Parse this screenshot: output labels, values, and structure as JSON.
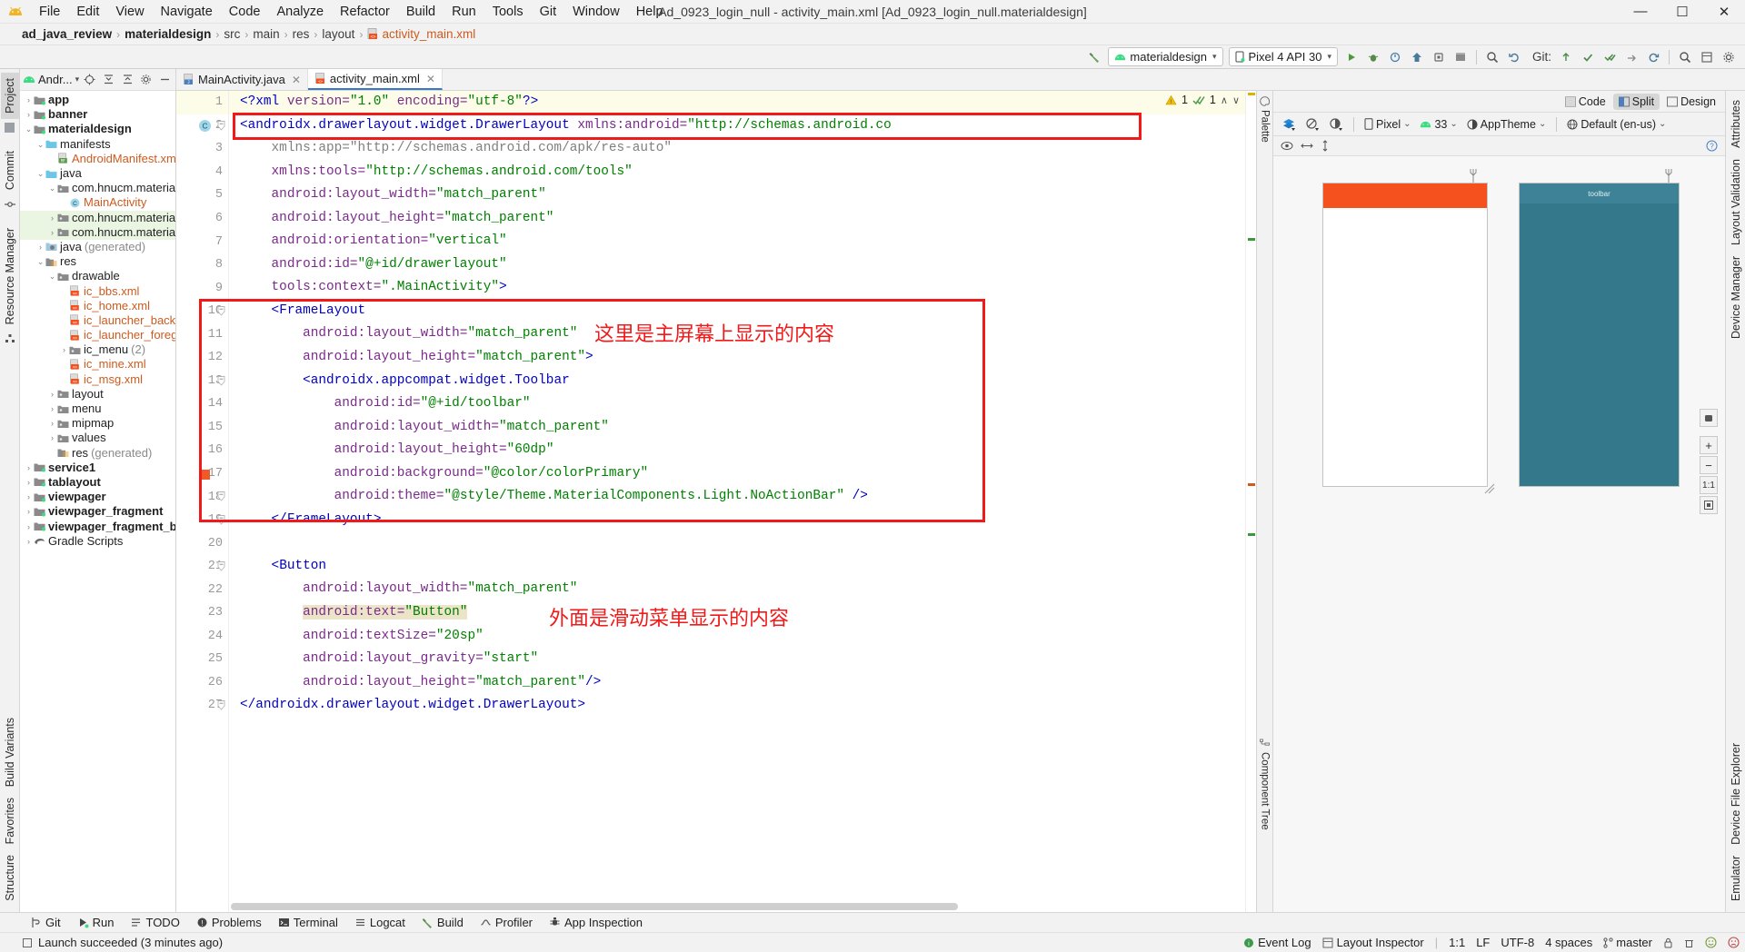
{
  "window": {
    "title": "Ad_0923_login_null - activity_main.xml [Ad_0923_login_null.materialdesign]",
    "minimize": "—",
    "maximize": "☐",
    "close": "✕"
  },
  "menubar": {
    "items": [
      {
        "label": "File"
      },
      {
        "label": "Edit"
      },
      {
        "label": "View"
      },
      {
        "label": "Navigate"
      },
      {
        "label": "Code"
      },
      {
        "label": "Analyze"
      },
      {
        "label": "Refactor"
      },
      {
        "label": "Build"
      },
      {
        "label": "Run"
      },
      {
        "label": "Tools"
      },
      {
        "label": "Git"
      },
      {
        "label": "Window"
      },
      {
        "label": "Help"
      }
    ]
  },
  "breadcrumb": {
    "items": [
      "ad_java_review",
      "materialdesign",
      "src",
      "main",
      "res",
      "layout",
      "activity_main.xml"
    ]
  },
  "toolbar": {
    "run_config": "materialdesign",
    "device": "Pixel 4 API 30",
    "git_label": "Git:",
    "caret": "▾"
  },
  "left_tool_strip": {
    "tabs": [
      "Project",
      "Commit",
      "Resource Manager"
    ],
    "bottom_tabs": [
      "Structure",
      "Favorites",
      "Build Variants"
    ]
  },
  "right_tool_strip": {
    "tabs": [
      "Attributes",
      "Layout Validation",
      "Device Manager",
      "Emulator",
      "Device File Explorer"
    ]
  },
  "project_panel": {
    "title": "Andr...",
    "tree": [
      {
        "indent": 0,
        "arrow": "›",
        "icon": "module-icon",
        "label": "app",
        "bold": true
      },
      {
        "indent": 0,
        "arrow": "›",
        "icon": "module-icon",
        "label": "banner",
        "bold": true
      },
      {
        "indent": 0,
        "arrow": "⌄",
        "icon": "module-icon",
        "label": "materialdesign",
        "bold": true
      },
      {
        "indent": 1,
        "arrow": "⌄",
        "icon": "folder-icon",
        "label": "manifests",
        "bold": false
      },
      {
        "indent": 2,
        "arrow": "",
        "icon": "manifest-file-icon",
        "label": "AndroidManifest.xml",
        "color": "orange"
      },
      {
        "indent": 1,
        "arrow": "⌄",
        "icon": "folder-icon",
        "label": "java",
        "bold": false
      },
      {
        "indent": 2,
        "arrow": "⌄",
        "icon": "package-icon",
        "label": "com.hnucm.materialdes",
        "bold": false
      },
      {
        "indent": 3,
        "arrow": "",
        "icon": "class-icon",
        "label": "MainActivity",
        "color": "orange"
      },
      {
        "indent": 2,
        "arrow": "›",
        "icon": "package-icon",
        "label": "com.hnucm.materialdes",
        "selected": true
      },
      {
        "indent": 2,
        "arrow": "›",
        "icon": "package-icon",
        "label": "com.hnucm.materialdes",
        "selected": true
      },
      {
        "indent": 1,
        "arrow": "›",
        "icon": "gen-folder-icon",
        "label": "java",
        "suffix": "(generated)"
      },
      {
        "indent": 1,
        "arrow": "⌄",
        "icon": "res-folder-icon",
        "label": "res",
        "bold": false
      },
      {
        "indent": 2,
        "arrow": "⌄",
        "icon": "package-icon",
        "label": "drawable",
        "bold": false
      },
      {
        "indent": 3,
        "arrow": "",
        "icon": "xml-file-icon",
        "label": "ic_bbs.xml",
        "color": "orange"
      },
      {
        "indent": 3,
        "arrow": "",
        "icon": "xml-file-icon",
        "label": "ic_home.xml",
        "color": "orange"
      },
      {
        "indent": 3,
        "arrow": "",
        "icon": "xml-file-icon",
        "label": "ic_launcher_backgro",
        "color": "orange"
      },
      {
        "indent": 3,
        "arrow": "",
        "icon": "xml-file-icon",
        "label": "ic_launcher_foregrou",
        "color": "orange"
      },
      {
        "indent": 3,
        "arrow": "›",
        "icon": "package-icon",
        "label": "ic_menu",
        "suffix": "(2)"
      },
      {
        "indent": 3,
        "arrow": "",
        "icon": "xml-file-icon",
        "label": "ic_mine.xml",
        "color": "orange"
      },
      {
        "indent": 3,
        "arrow": "",
        "icon": "xml-file-icon",
        "label": "ic_msg.xml",
        "color": "orange"
      },
      {
        "indent": 2,
        "arrow": "›",
        "icon": "package-icon",
        "label": "layout",
        "bold": false
      },
      {
        "indent": 2,
        "arrow": "›",
        "icon": "package-icon",
        "label": "menu",
        "bold": false
      },
      {
        "indent": 2,
        "arrow": "›",
        "icon": "package-icon",
        "label": "mipmap",
        "bold": false
      },
      {
        "indent": 2,
        "arrow": "›",
        "icon": "package-icon",
        "label": "values",
        "bold": false
      },
      {
        "indent": 2,
        "arrow": "",
        "icon": "res-folder-icon",
        "label": "res",
        "suffix": "(generated)"
      },
      {
        "indent": 0,
        "arrow": "›",
        "icon": "module-icon",
        "label": "service1",
        "bold": true
      },
      {
        "indent": 0,
        "arrow": "›",
        "icon": "module-icon",
        "label": "tablayout",
        "bold": true
      },
      {
        "indent": 0,
        "arrow": "›",
        "icon": "module-icon",
        "label": "viewpager",
        "bold": true
      },
      {
        "indent": 0,
        "arrow": "›",
        "icon": "module-icon",
        "label": "viewpager_fragment",
        "bold": true
      },
      {
        "indent": 0,
        "arrow": "›",
        "icon": "module-icon",
        "label": "viewpager_fragment_bottom",
        "bold": true
      },
      {
        "indent": 0,
        "arrow": "›",
        "icon": "gradle-icon",
        "label": "Gradle Scripts",
        "bold": false
      }
    ]
  },
  "editor_tabs": [
    {
      "label": "MainActivity.java",
      "icon": "java-file-icon",
      "active": false,
      "close": "✕"
    },
    {
      "label": "activity_main.xml",
      "icon": "xml-file-icon",
      "active": true,
      "close": "✕"
    }
  ],
  "inspection": {
    "warning_count": "1",
    "check_count": "1",
    "up": "∧",
    "down": "∨"
  },
  "code": {
    "lines": [
      {
        "n": 1,
        "current": true,
        "tokens": [
          {
            "t": "<?",
            "c": "k-pi"
          },
          {
            "t": "xml",
            "c": "k-pi"
          },
          {
            "t": " version=",
            "c": "k-attr"
          },
          {
            "t": "\"1.0\"",
            "c": "k-str"
          },
          {
            "t": " encoding=",
            "c": "k-attr"
          },
          {
            "t": "\"utf-8\"",
            "c": "k-str"
          },
          {
            "t": "?>",
            "c": "k-pi"
          }
        ],
        "indent": 0
      },
      {
        "n": 2,
        "tokens": [
          {
            "t": "<",
            "c": "k-tag"
          },
          {
            "t": "androidx.drawerlayout.widget.DrawerLayout",
            "c": "k-tag"
          },
          {
            "t": " xmlns:android=",
            "c": "k-attr"
          },
          {
            "t": "\"http://schemas.android.co",
            "c": "k-str"
          }
        ],
        "indent": 0,
        "gutter_icon": "class-icon",
        "fold": true
      },
      {
        "n": 3,
        "tokens": [
          {
            "t": "xmlns:app=",
            "c": "k-gray"
          },
          {
            "t": "\"http://schemas.android.com/apk/res-auto\"",
            "c": "k-gray"
          }
        ],
        "indent": 1
      },
      {
        "n": 4,
        "tokens": [
          {
            "t": "xmlns:tools=",
            "c": "k-attr"
          },
          {
            "t": "\"http://schemas.android.com/tools\"",
            "c": "k-str"
          }
        ],
        "indent": 1
      },
      {
        "n": 5,
        "tokens": [
          {
            "t": "android:layout_width=",
            "c": "k-attr"
          },
          {
            "t": "\"match_parent\"",
            "c": "k-str"
          }
        ],
        "indent": 1
      },
      {
        "n": 6,
        "tokens": [
          {
            "t": "android:layout_height=",
            "c": "k-attr"
          },
          {
            "t": "\"match_parent\"",
            "c": "k-str"
          }
        ],
        "indent": 1
      },
      {
        "n": 7,
        "tokens": [
          {
            "t": "android:orientation=",
            "c": "k-attr"
          },
          {
            "t": "\"vertical\"",
            "c": "k-str"
          }
        ],
        "indent": 1
      },
      {
        "n": 8,
        "tokens": [
          {
            "t": "android:id=",
            "c": "k-attr"
          },
          {
            "t": "\"@+id/drawerlayout\"",
            "c": "k-str"
          }
        ],
        "indent": 1
      },
      {
        "n": 9,
        "tokens": [
          {
            "t": "tools:context=",
            "c": "k-attr"
          },
          {
            "t": "\".MainActivity\"",
            "c": "k-str"
          },
          {
            "t": ">",
            "c": "k-tag"
          }
        ],
        "indent": 1
      },
      {
        "n": 10,
        "tokens": [
          {
            "t": "<",
            "c": "k-tag"
          },
          {
            "t": "FrameLayout",
            "c": "k-tag"
          }
        ],
        "indent": 1,
        "fold": true
      },
      {
        "n": 11,
        "tokens": [
          {
            "t": "android:layout_width=",
            "c": "k-attr"
          },
          {
            "t": "\"match_parent\"",
            "c": "k-str"
          }
        ],
        "indent": 2
      },
      {
        "n": 12,
        "tokens": [
          {
            "t": "android:layout_height=",
            "c": "k-attr"
          },
          {
            "t": "\"match_parent\"",
            "c": "k-str"
          },
          {
            "t": ">",
            "c": "k-tag"
          }
        ],
        "indent": 2
      },
      {
        "n": 13,
        "tokens": [
          {
            "t": "<",
            "c": "k-tag"
          },
          {
            "t": "androidx.appcompat.widget.Toolbar",
            "c": "k-tag"
          }
        ],
        "indent": 2,
        "fold": true
      },
      {
        "n": 14,
        "tokens": [
          {
            "t": "android:id=",
            "c": "k-attr"
          },
          {
            "t": "\"@+id/toolbar\"",
            "c": "k-str"
          }
        ],
        "indent": 3
      },
      {
        "n": 15,
        "tokens": [
          {
            "t": "android:layout_width=",
            "c": "k-attr"
          },
          {
            "t": "\"match_parent\"",
            "c": "k-str"
          }
        ],
        "indent": 3
      },
      {
        "n": 16,
        "tokens": [
          {
            "t": "android:layout_height=",
            "c": "k-attr"
          },
          {
            "t": "\"60dp\"",
            "c": "k-str"
          }
        ],
        "indent": 3
      },
      {
        "n": 17,
        "tokens": [
          {
            "t": "android:background=",
            "c": "k-attr"
          },
          {
            "t": "\"@color/colorPrimary\"",
            "c": "k-str"
          }
        ],
        "indent": 3,
        "gutter_color": "#f05a28"
      },
      {
        "n": 18,
        "tokens": [
          {
            "t": "android:theme=",
            "c": "k-attr"
          },
          {
            "t": "\"@style/Theme.MaterialComponents.Light.NoActionBar\"",
            "c": "k-str"
          },
          {
            "t": " />",
            "c": "k-tag"
          }
        ],
        "indent": 3,
        "fold": true
      },
      {
        "n": 19,
        "tokens": [
          {
            "t": "</",
            "c": "k-tag"
          },
          {
            "t": "FrameLayout",
            "c": "k-tag"
          },
          {
            "t": ">",
            "c": "k-tag"
          }
        ],
        "indent": 1,
        "fold": true
      },
      {
        "n": 20,
        "tokens": [],
        "indent": 0
      },
      {
        "n": 21,
        "tokens": [
          {
            "t": "<",
            "c": "k-tag"
          },
          {
            "t": "Button",
            "c": "k-tag"
          }
        ],
        "indent": 1,
        "fold": true
      },
      {
        "n": 22,
        "tokens": [
          {
            "t": "android:layout_width=",
            "c": "k-attr"
          },
          {
            "t": "\"match_parent\"",
            "c": "k-str"
          }
        ],
        "indent": 2
      },
      {
        "n": 23,
        "tokens": [
          {
            "t": "android:text=",
            "c": "k-attr"
          },
          {
            "t": "\"Button\"",
            "c": "k-str"
          }
        ],
        "indent": 2,
        "highlight": true
      },
      {
        "n": 24,
        "tokens": [
          {
            "t": "android:textSize=",
            "c": "k-attr"
          },
          {
            "t": "\"20sp\"",
            "c": "k-str"
          }
        ],
        "indent": 2
      },
      {
        "n": 25,
        "tokens": [
          {
            "t": "android:layout_gravity=",
            "c": "k-attr"
          },
          {
            "t": "\"start\"",
            "c": "k-str"
          }
        ],
        "indent": 2
      },
      {
        "n": 26,
        "tokens": [
          {
            "t": "android:layout_height=",
            "c": "k-attr"
          },
          {
            "t": "\"match_parent\"",
            "c": "k-str"
          },
          {
            "t": "/>",
            "c": "k-tag"
          }
        ],
        "indent": 2
      },
      {
        "n": 27,
        "tokens": [
          {
            "t": "</",
            "c": "k-tag"
          },
          {
            "t": "androidx.drawerlayout.widget.DrawerLayout",
            "c": "k-tag"
          },
          {
            "t": ">",
            "c": "k-tag"
          }
        ],
        "indent": 0,
        "fold": true
      }
    ]
  },
  "annotations": [
    {
      "text": "这里是主屏幕上显示的内容",
      "name": "annotation-main-screen"
    },
    {
      "text": "外面是滑动菜单显示的内容",
      "name": "annotation-drawer-menu"
    }
  ],
  "preview": {
    "modes": [
      {
        "label": "Code",
        "active": false
      },
      {
        "label": "Split",
        "active": true
      },
      {
        "label": "Design",
        "active": false
      }
    ],
    "palette_label": "Palette",
    "component_tree_label": "Component Tree",
    "device_combo": "Pixel",
    "api_combo": "33",
    "theme_combo": "AppTheme",
    "locale_combo": "Default (en-us)",
    "caret": "⌄",
    "toolbar_text": "toolbar",
    "zoom_ratio": "1:1",
    "zoom_in": "+",
    "zoom_out": "−",
    "colors": {
      "button_orange": "#f4511e",
      "toolbar_teal": "#34788c",
      "preview_bg": "#f7f7f7"
    }
  },
  "bottom_bar": {
    "items": [
      {
        "label": "Git",
        "icon": "git-icon"
      },
      {
        "label": "Run",
        "icon": "run-icon"
      },
      {
        "label": "TODO",
        "icon": "todo-icon"
      },
      {
        "label": "Problems",
        "icon": "problems-icon"
      },
      {
        "label": "Terminal",
        "icon": "terminal-icon"
      },
      {
        "label": "Logcat",
        "icon": "logcat-icon"
      },
      {
        "label": "Build",
        "icon": "build-icon"
      },
      {
        "label": "Profiler",
        "icon": "profiler-icon"
      },
      {
        "label": "App Inspection",
        "icon": "app-inspection-icon"
      }
    ]
  },
  "status_bar": {
    "message": "Launch succeeded (3 minutes ago)",
    "event_log": "Event Log",
    "layout_inspector": "Layout Inspector",
    "caret_pos": "1:1",
    "line_sep": "LF",
    "encoding": "UTF-8",
    "indent": "4 spaces",
    "branch": "master",
    "lock": "🔒"
  }
}
